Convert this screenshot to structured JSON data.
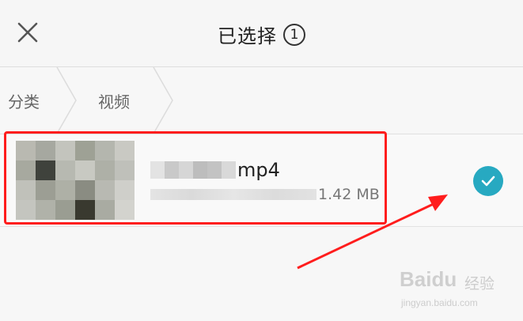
{
  "header": {
    "title": "已选择",
    "selected_count": "1"
  },
  "breadcrumb": {
    "items": [
      {
        "label": "分类"
      },
      {
        "label": "视频"
      }
    ]
  },
  "file": {
    "name_visible": "mp4",
    "size": "1.42 MB",
    "selected": true
  },
  "annotation": {
    "highlight_color": "#ff1d1d",
    "check_color": "#27a9c1"
  },
  "watermark": {
    "brand": "Baidu",
    "brand_cn": "经验",
    "url": "jingyan.baidu.com"
  }
}
